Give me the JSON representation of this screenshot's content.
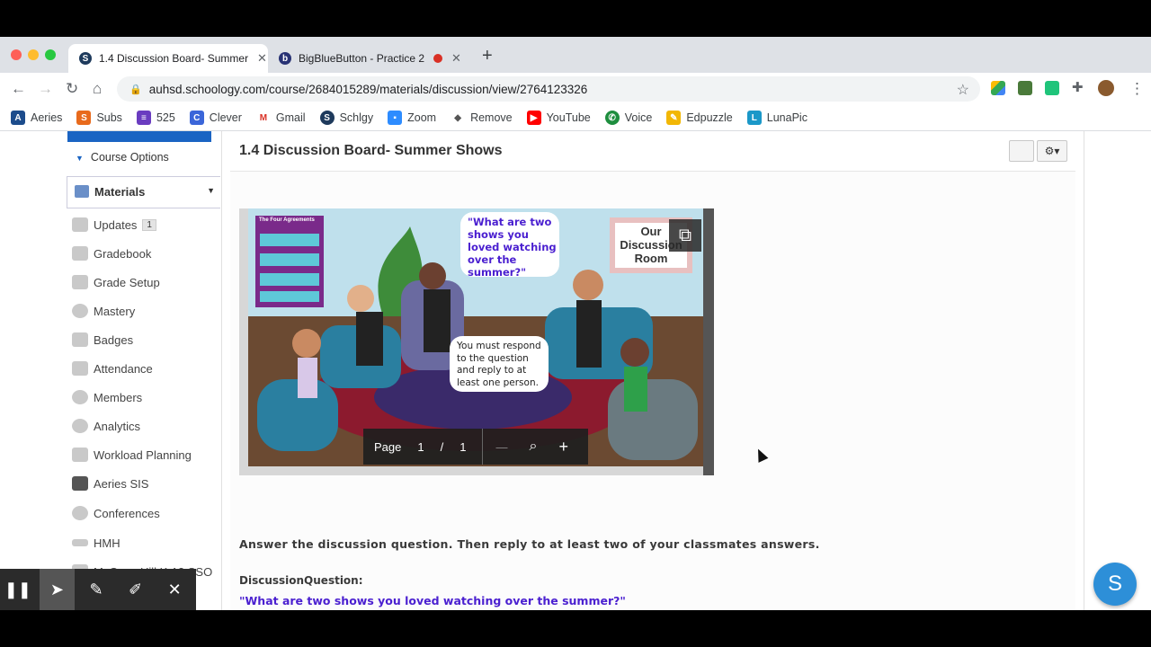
{
  "browser": {
    "tabs": [
      {
        "title": "1.4 Discussion Board- Summer Shows",
        "favicon": "S",
        "active": true
      },
      {
        "title": "BigBlueButton - Practice 2",
        "favicon": "b",
        "active": false
      }
    ],
    "url": "auhsd.schoology.com/course/2684015289/materials/discussion/view/2764123326",
    "bookmarks": [
      "Aeries",
      "Subs",
      "525",
      "Clever",
      "Gmail",
      "Schlgy",
      "Zoom",
      "Remove",
      "YouTube",
      "Voice",
      "Edpuzzle",
      "LunaPic"
    ]
  },
  "sidebar": {
    "course_options": "Course Options",
    "materials": "Materials",
    "items": [
      {
        "label": "Updates",
        "badge": "1"
      },
      {
        "label": "Gradebook"
      },
      {
        "label": "Grade Setup"
      },
      {
        "label": "Mastery"
      },
      {
        "label": "Badges"
      },
      {
        "label": "Attendance"
      },
      {
        "label": "Members"
      },
      {
        "label": "Analytics"
      },
      {
        "label": "Workload Planning"
      },
      {
        "label": "Aeries SIS"
      },
      {
        "label": "Conferences"
      },
      {
        "label": "HMH"
      },
      {
        "label": "McGraw Hill K-12 SSO"
      }
    ]
  },
  "main": {
    "title": "1.4 Discussion Board- Summer Shows",
    "image": {
      "poster_title": "The Four Agreements",
      "question_bubble": "\"What are two shows you loved watching over the summer?\"",
      "respond_bubble": "You must respond to the question and reply to at least one person.",
      "sign": "Our Discussion Room",
      "viewer": {
        "page_label": "Page",
        "page": "1",
        "separator": "/",
        "total": "1",
        "minus": "—",
        "plus": "+"
      }
    },
    "instructions": "Answer the discussion question. Then reply to at least two of your classmates answers.",
    "dq_label": "DiscussionQuestion:",
    "dq_text": "\"What are two shows you loved watching over the summer?\""
  },
  "fab": "S",
  "colors": {
    "accent": "#1a64c3",
    "question": "#4a1fd0",
    "fab": "#2d8fd8"
  }
}
